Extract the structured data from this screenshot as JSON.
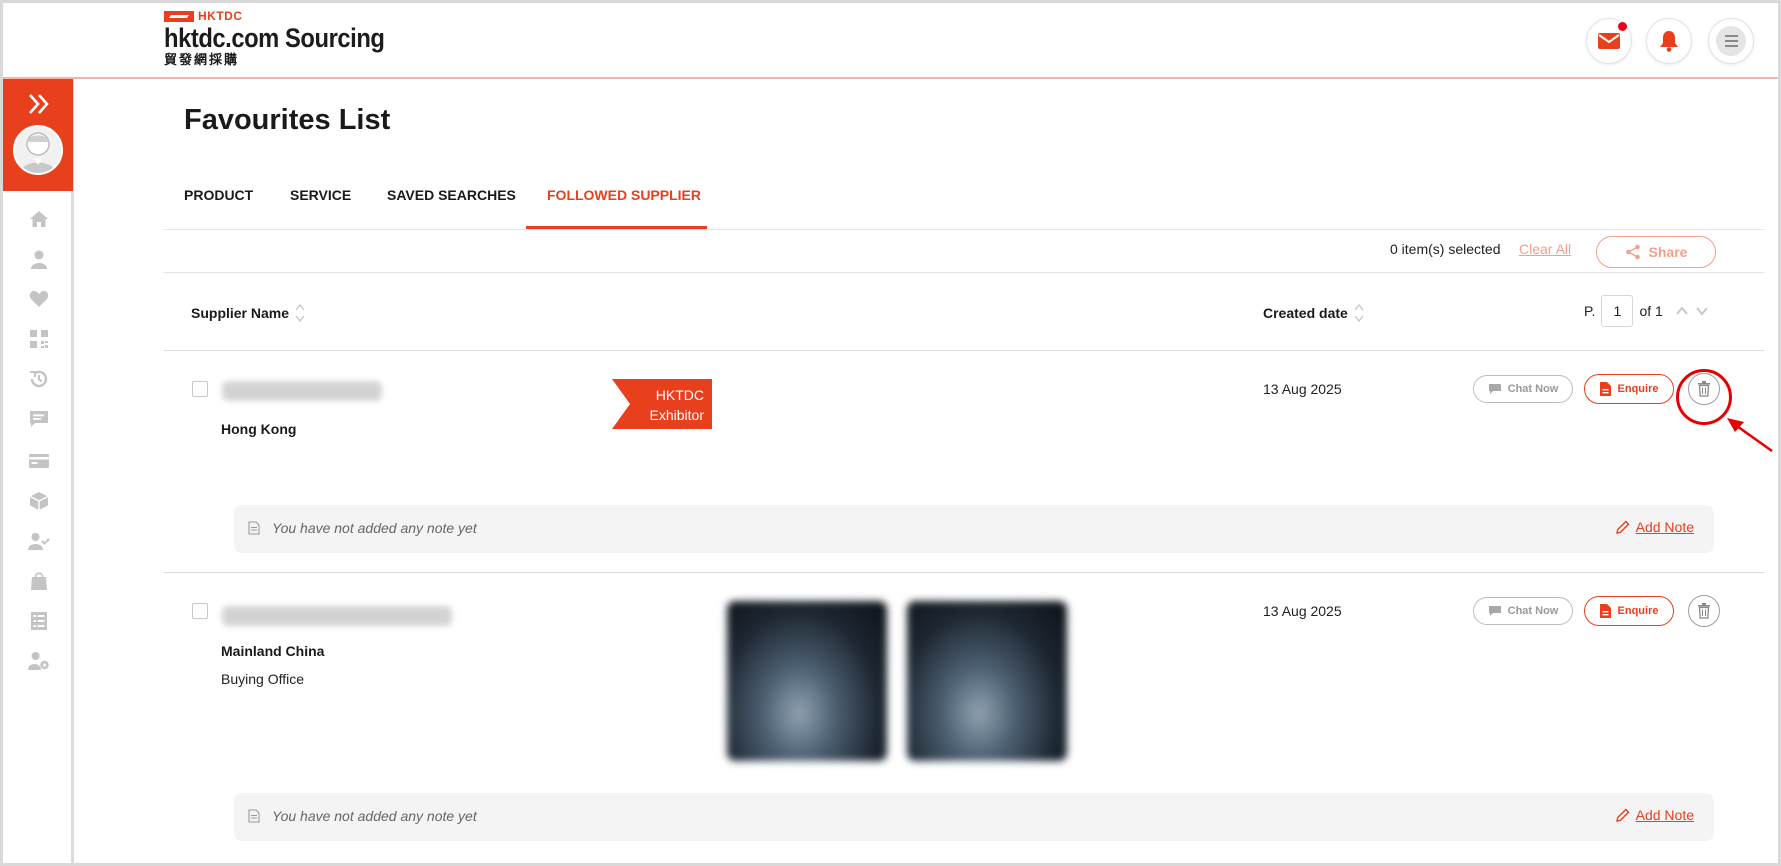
{
  "header": {
    "logo_mark": "HKTDC",
    "logo_main": "hktdc.com Sourcing",
    "logo_sub": "貿發網採購",
    "icons": [
      "mail-icon",
      "bell-icon",
      "menu-icon"
    ],
    "mail_has_notification": true
  },
  "sidebar": {
    "icons": [
      "double-chevron-right-icon",
      "avatar",
      "home-icon",
      "user-icon",
      "heart-icon",
      "qr-code-icon",
      "history-icon",
      "chat-icon",
      "card-icon",
      "box-icon",
      "user-check-icon",
      "bag-icon",
      "list-icon",
      "user-settings-icon"
    ]
  },
  "page": {
    "title": "Favourites List"
  },
  "tabs": [
    {
      "label": "PRODUCT",
      "active": false
    },
    {
      "label": "SERVICE",
      "active": false
    },
    {
      "label": "SAVED SEARCHES",
      "active": false
    },
    {
      "label": "FOLLOWED SUPPLIER",
      "active": true
    }
  ],
  "selection": {
    "count_text": "0 item(s) selected",
    "clear_all": "Clear All",
    "share": "Share"
  },
  "table": {
    "col_supplier": "Supplier Name",
    "col_created": "Created date",
    "pager_prefix": "P.",
    "pager_value": "1",
    "pager_suffix": "of 1"
  },
  "rows": [
    {
      "region": "Hong Kong",
      "badge_line1": "HKTDC",
      "badge_line2": "Exhibitor",
      "date": "13 Aug 2025",
      "chat": "Chat Now",
      "enquire": "Enquire",
      "note": "You have not added any note yet",
      "add_note": "Add Note"
    },
    {
      "region": "Mainland China",
      "business_type": "Buying Office",
      "date": "13 Aug 2025",
      "chat": "Chat Now",
      "enquire": "Enquire",
      "note": "You have not added any note yet",
      "add_note": "Add Note"
    }
  ],
  "colors": {
    "accent": "#e8401c",
    "accent_light": "#f2a08b",
    "annotation": "#e80000"
  }
}
